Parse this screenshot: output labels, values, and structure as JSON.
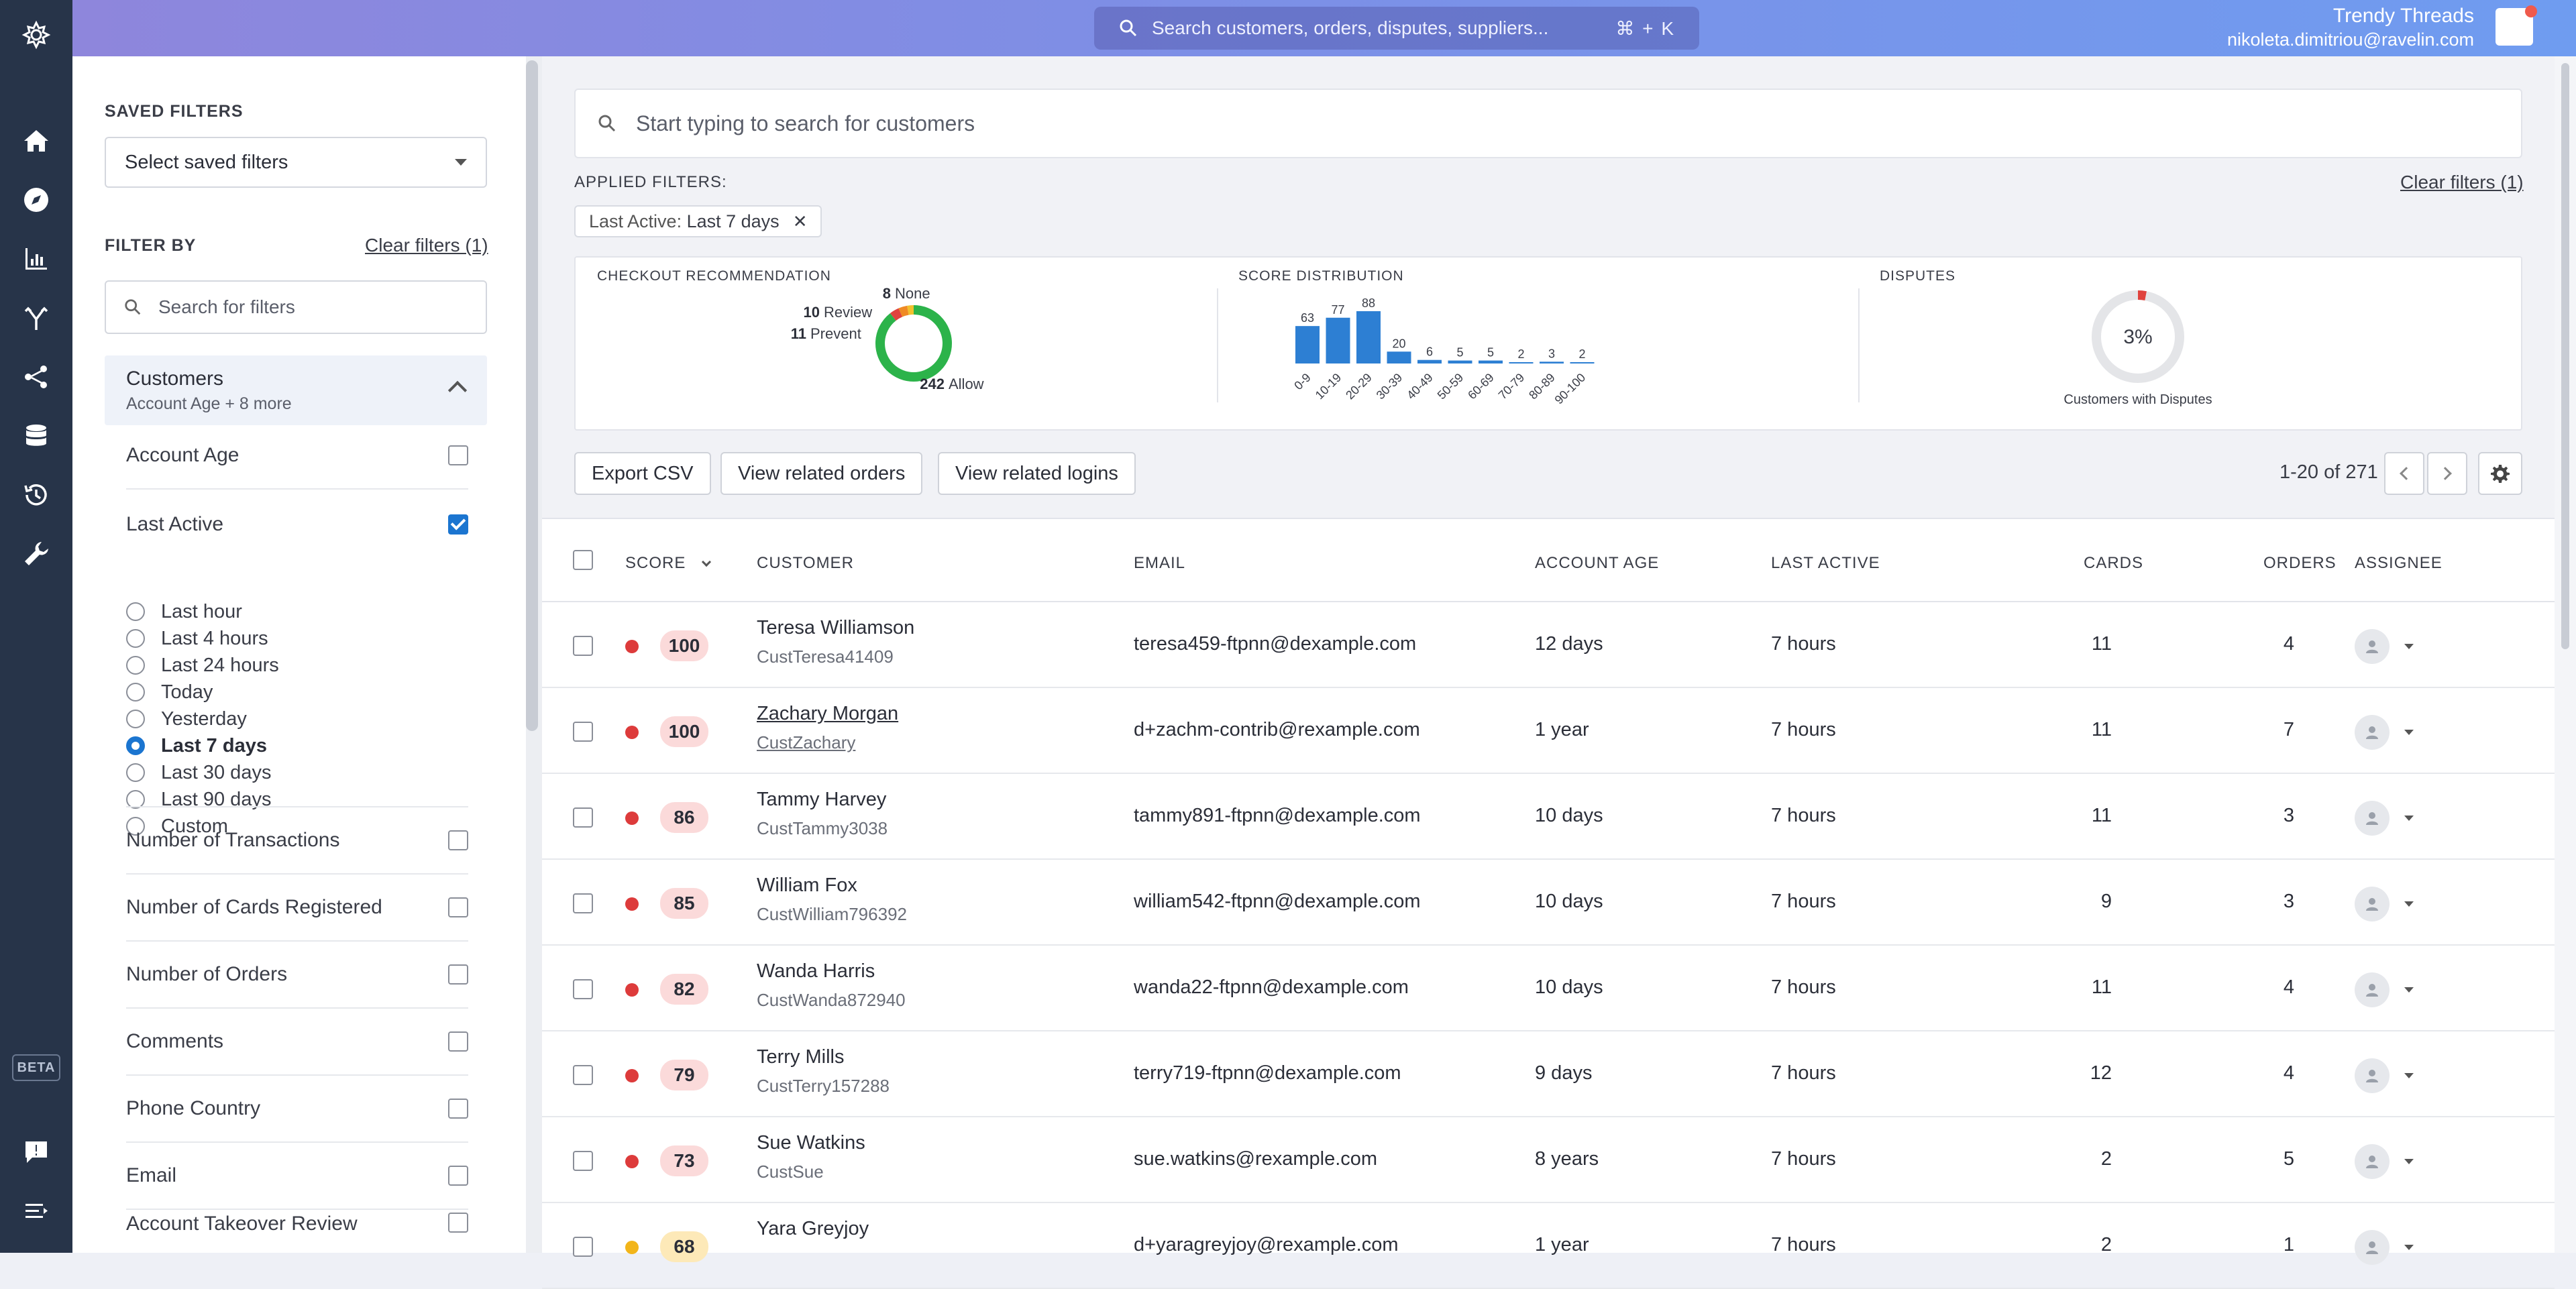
{
  "topbar": {
    "search_placeholder": "Search customers, orders, disputes, suppliers...",
    "search_shortcut": "⌘ + K",
    "account_name": "Trendy Threads",
    "account_email": "nikoleta.dimitriou@ravelin.com"
  },
  "nav": {
    "items": [
      "logo-icon",
      "home-icon",
      "compass-icon",
      "bar-chart-icon",
      "branch-icon",
      "share-icon",
      "database-icon",
      "history-icon",
      "wrench-icon"
    ],
    "beta_label": "BETA",
    "bottom_items": [
      "feedback-icon",
      "collapse-icon"
    ]
  },
  "sidebar": {
    "saved_filters_title": "SAVED FILTERS",
    "saved_filters_select": "Select saved filters",
    "filter_by_title": "FILTER BY",
    "clear_filters": "Clear filters (1)",
    "search_placeholder": "Search for filters",
    "group": {
      "title": "Customers",
      "subtitle": "Account Age + 8 more"
    },
    "filters": [
      {
        "label": "Account Age",
        "checked": false
      },
      {
        "label": "Last Active",
        "checked": true
      },
      {
        "label": "Number of Transactions",
        "checked": false
      },
      {
        "label": "Number of Cards Registered",
        "checked": false
      },
      {
        "label": "Number of Orders",
        "checked": false
      },
      {
        "label": "Comments",
        "checked": false
      },
      {
        "label": "Phone Country",
        "checked": false
      },
      {
        "label": "Email",
        "checked": false
      },
      {
        "label": "Account Takeover Review",
        "checked": false
      }
    ],
    "last_active_options": [
      "Last hour",
      "Last 4 hours",
      "Last 24 hours",
      "Today",
      "Yesterday",
      "Last 7 days",
      "Last 30 days",
      "Last 90 days",
      "Custom"
    ],
    "last_active_selected": "Last 7 days"
  },
  "main": {
    "search_placeholder": "Start typing to search for customers",
    "applied_filters_label": "APPLIED FILTERS:",
    "clear_filters": "Clear filters (1)",
    "chip_key": "Last Active:",
    "chip_value": "Last 7 days",
    "chip_close": "✕",
    "buttons": {
      "export": "Export CSV",
      "orders": "View related orders",
      "logins": "View related logins"
    },
    "pagination": "1-20 of 271"
  },
  "stats": {
    "checkout_title": "CHECKOUT RECOMMENDATION",
    "checkout": [
      {
        "count": "8",
        "label": "None",
        "color": "#f2c12e",
        "value": 8
      },
      {
        "count": "10",
        "label": "Review",
        "color": "#f08a24",
        "value": 10
      },
      {
        "count": "11",
        "label": "Prevent",
        "color": "#e0433e",
        "value": 11
      },
      {
        "count": "242",
        "label": "Allow",
        "color": "#2cb34a",
        "value": 242
      }
    ],
    "score_title": "SCORE DISTRIBUTION",
    "disputes_title": "DISPUTES",
    "disputes_pct": "3%",
    "disputes_value": 3,
    "disputes_caption": "Customers with Disputes"
  },
  "chart_data": {
    "type": "bar",
    "title": "SCORE DISTRIBUTION",
    "categories": [
      "0-9",
      "10-19",
      "20-29",
      "30-39",
      "40-49",
      "50-59",
      "60-69",
      "70-79",
      "80-89",
      "90-100"
    ],
    "values": [
      63,
      77,
      88,
      20,
      6,
      5,
      5,
      2,
      3,
      2
    ],
    "ylim": [
      0,
      88
    ],
    "grid": false,
    "color": "#2d7fd3"
  },
  "table": {
    "headers": {
      "score": "SCORE",
      "customer": "CUSTOMER",
      "email": "EMAIL",
      "account_age": "ACCOUNT AGE",
      "last_active": "LAST ACTIVE",
      "cards": "CARDS",
      "orders": "ORDERS",
      "assignee": "ASSIGNEE"
    },
    "rows": [
      {
        "score": "100",
        "name": "Teresa Williamson",
        "id": "CustTeresa41409",
        "email": "teresa459-ftpnn@dexample.com",
        "age": "12 days",
        "active": "7 hours",
        "cards": "11",
        "orders": "4",
        "level": "red"
      },
      {
        "score": "100",
        "name": "Zachary Morgan",
        "id": "CustZachary",
        "email": "d+zachm-contrib@rexample.com",
        "age": "1 year",
        "active": "7 hours",
        "cards": "11",
        "orders": "7",
        "level": "red"
      },
      {
        "score": "86",
        "name": "Tammy Harvey",
        "id": "CustTammy3038",
        "email": "tammy891-ftpnn@dexample.com",
        "age": "10 days",
        "active": "7 hours",
        "cards": "11",
        "orders": "3",
        "level": "red"
      },
      {
        "score": "85",
        "name": "William Fox",
        "id": "CustWilliam796392",
        "email": "william542-ftpnn@dexample.com",
        "age": "10 days",
        "active": "7 hours",
        "cards": "9",
        "orders": "3",
        "level": "red"
      },
      {
        "score": "82",
        "name": "Wanda Harris",
        "id": "CustWanda872940",
        "email": "wanda22-ftpnn@dexample.com",
        "age": "10 days",
        "active": "7 hours",
        "cards": "11",
        "orders": "4",
        "level": "red"
      },
      {
        "score": "79",
        "name": "Terry Mills",
        "id": "CustTerry157288",
        "email": "terry719-ftpnn@dexample.com",
        "age": "9 days",
        "active": "7 hours",
        "cards": "12",
        "orders": "4",
        "level": "red"
      },
      {
        "score": "73",
        "name": "Sue Watkins",
        "id": "CustSue",
        "email": "sue.watkins@rexample.com",
        "age": "8 years",
        "active": "7 hours",
        "cards": "2",
        "orders": "5",
        "level": "red"
      },
      {
        "score": "68",
        "name": "Yara Greyjoy",
        "id": "",
        "email": "d+yaragreyjoy@rexample.com",
        "age": "1 year",
        "active": "7 hours",
        "cards": "2",
        "orders": "1",
        "level": "amber"
      }
    ]
  },
  "colors": {
    "red_dot": "#dd3b3b",
    "amber_dot": "#f2b51a",
    "red_badge": "#fbdada",
    "amber_badge": "#fde9b8",
    "accent": "#1b75d0"
  }
}
